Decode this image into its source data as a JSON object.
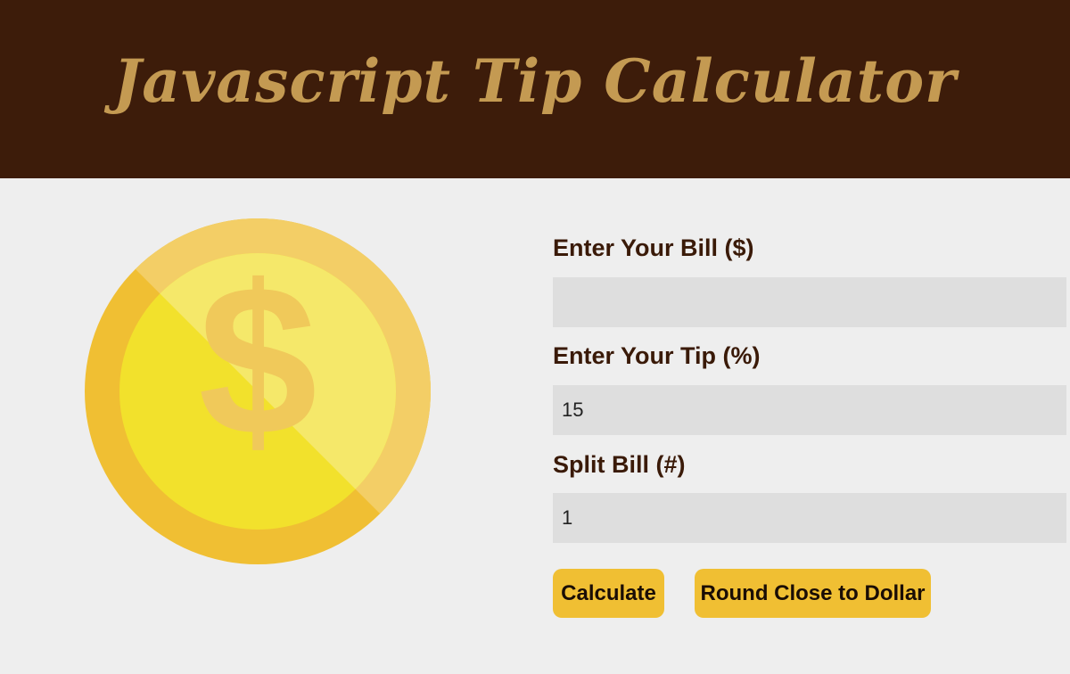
{
  "header": {
    "title": "Javascript Tip Calculator"
  },
  "coin": {
    "icon": "dollar-coin-icon",
    "glyph": "$",
    "colors": {
      "outer_dark": "#f0bf33",
      "outer_light": "#f3ce66",
      "inner_dark": "#f2e12c",
      "inner_light": "#f5e86a",
      "glyph": "#f0c95a"
    }
  },
  "form": {
    "bill": {
      "label": "Enter Your Bill ($)",
      "value": "",
      "placeholder": ""
    },
    "tip": {
      "label": "Enter Your Tip (%)",
      "value": "15",
      "placeholder": ""
    },
    "split": {
      "label": "Split Bill (#)",
      "value": "1",
      "placeholder": ""
    }
  },
  "buttons": {
    "calculate_label": "Calculate",
    "round_label": "Round Close to Dollar"
  },
  "theme": {
    "header_bg": "#3d1c0a",
    "title_color": "#c49a52",
    "page_bg": "#eeeeee",
    "label_color": "#3a1a08",
    "input_bg": "#dedede",
    "button_bg": "#f0bf33"
  }
}
